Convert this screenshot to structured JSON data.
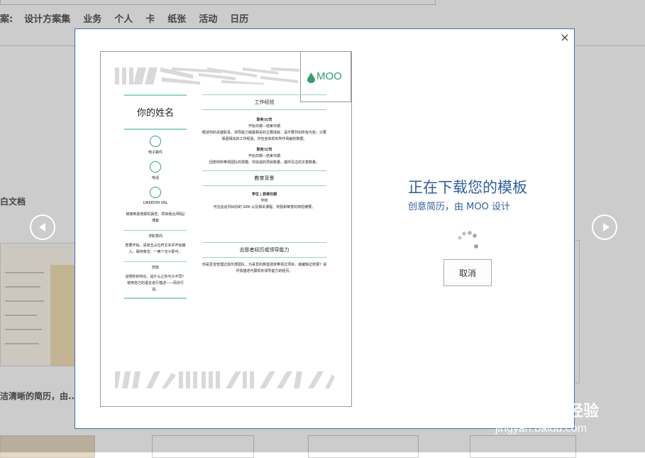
{
  "background": {
    "suggest_lead": "案:",
    "suggest_items": [
      "设计方案集",
      "业务",
      "个人",
      "卡",
      "纸张",
      "活动",
      "日历"
    ],
    "section_title": "白文档",
    "caption": "洁清晰的简历，由..."
  },
  "dialog": {
    "close_label": "×",
    "status_title": "正在下载您的模板",
    "status_subtitle": "创意简历，由 MOO 设计",
    "cancel_label": "取消"
  },
  "preview": {
    "logo_text": "MOO",
    "name": "你的姓名",
    "email": "电子邮件",
    "phone": "电话",
    "linkedin": "LINKEDIN URL",
    "links_text": "链接到其他联机属性：项目组合/网站/博客",
    "objective_head": "求职意向",
    "objective_text": "若要开始，请单击占位符文本并开始键入。保持简洁：一两个句子即可。",
    "skills_head": "技能",
    "skills_text": "说明你的特长。是什么让你与众不同？使用自己的语言进行描述——而非行话。",
    "work_head": "工作经验",
    "job_title_1": "职务/公司",
    "job_dates_1": "开始日期－结束日期",
    "job_desc_1": "概述你的关键职责、领导能力或最相关的主要成就：请不要列出所有内容；只要保留相关的工作经验，并包含体现你所作贡献的数据。",
    "job_title_2": "职务/公司",
    "job_dates_2": "开始日期－结束日期",
    "job_desc_2": "回想你所带领团队的规模、你完成的项目数量，或你写过的文章数量。",
    "edu_head": "教育背景",
    "edu_title": "学位 | 获得日期",
    "edu_school": "学校",
    "edu_desc": "可在此处列出你的 GPA 以及相关课程、奖励和荣誉的简短摘要。",
    "volunteer_head": "志愿者经历或领导能力",
    "volunteer_desc": "你是否曾管理过俱乐部团队、为喜爱的慈善团体带领过项目，或编辑过校报？请尽情描述可展现你领导能力的经历。"
  },
  "watermark": {
    "brand_left": "Bai",
    "brand_right": "经验",
    "url": "jingyan.baidu.com"
  },
  "colors": {
    "accent": "#8fd6c9",
    "dialog_border": "#3b6fb6",
    "status_text": "#2e5ea1",
    "logo_green": "#2f9e6e"
  }
}
